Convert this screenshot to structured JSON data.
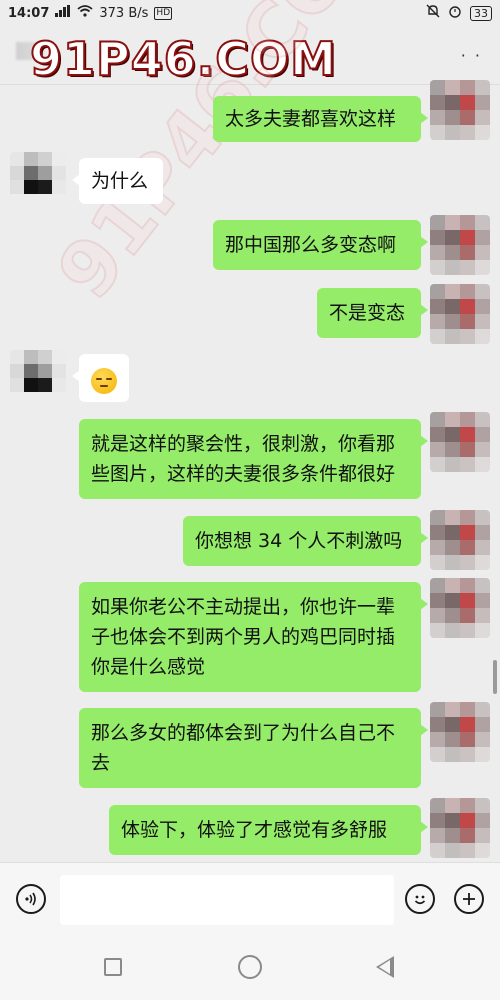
{
  "status_bar": {
    "time": "14:07",
    "network_speed": "373 B/s",
    "hd_label": "HD",
    "battery": "33"
  },
  "watermark": {
    "text": "91P46.COM"
  },
  "messages": [
    {
      "side": "out",
      "text": "太多夫妻都喜欢这样"
    },
    {
      "side": "in",
      "text": "为什么"
    },
    {
      "side": "out",
      "text": "那中国那么多变态啊"
    },
    {
      "side": "out",
      "text": "不是变态"
    },
    {
      "side": "in",
      "emoji": "pensive-face"
    },
    {
      "side": "out",
      "lines": [
        "就是这样的聚会性，很刺激，你看那",
        "些图片，这样的夫妻很多条件都很好"
      ]
    },
    {
      "side": "out",
      "text": "你想想 34 个人不刺激吗"
    },
    {
      "side": "out",
      "lines": [
        "如果你老公不主动提出，你也许一辈",
        "子也体会不到两个男人的鸡巴同时插",
        "你是什么感觉"
      ]
    },
    {
      "side": "out",
      "lines": [
        "那么多女的都体会到了为什么自己不",
        "去"
      ]
    },
    {
      "side": "out",
      "text": "体验下，体验了才感觉有多舒服"
    }
  ],
  "input": {
    "placeholder": ""
  },
  "icons": {
    "voice": "voice-icon",
    "emoji": "emoji-icon",
    "plus": "plus-icon",
    "nav_recent": "square-icon",
    "nav_home": "circle-icon",
    "nav_back": "triangle-back-icon"
  },
  "colors": {
    "outgoing_bubble": "#95ec69",
    "incoming_bubble": "#ffffff",
    "background": "#ededed",
    "watermark_outline": "#8a1010"
  }
}
